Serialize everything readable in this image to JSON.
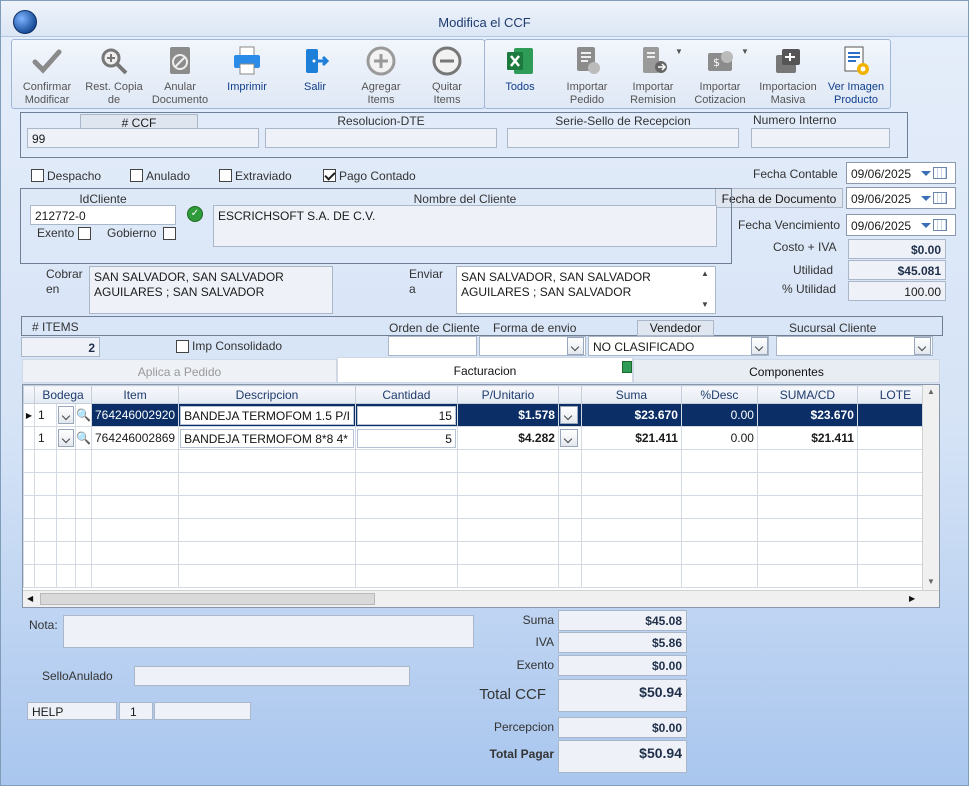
{
  "window": {
    "title": "Modifica el CCF"
  },
  "toolbar": {
    "confirm": [
      "Confirmar",
      "Modificar"
    ],
    "restore": [
      "Rest. Copia",
      "de"
    ],
    "cancel_doc": [
      "Anular",
      "Documento"
    ],
    "print": "Imprimir",
    "exit": "Salir",
    "add_items": [
      "Agregar",
      "Items"
    ],
    "remove_items": [
      "Quitar",
      "Items"
    ],
    "all": "Todos",
    "import_order": [
      "Importar",
      "Pedido"
    ],
    "import_remission": [
      "Importar",
      "Remision"
    ],
    "import_quote": [
      "Importar",
      "Cotizacion"
    ],
    "mass_import": [
      "Importacion",
      "Masiva"
    ],
    "view_image": [
      "Ver Imagen",
      "Producto"
    ]
  },
  "header": {
    "ccf_label": "# CCF",
    "ccf_value": "99",
    "resolution_label": "Resolucion-DTE",
    "resolution_value": "",
    "seal_label": "Serie-Sello de Recepcion",
    "seal_value": "",
    "internal_label": "Numero Interno",
    "internal_value": ""
  },
  "flags": {
    "despacho": {
      "label": "Despacho",
      "checked": false
    },
    "anulado": {
      "label": "Anulado",
      "checked": false
    },
    "extraviado": {
      "label": "Extraviado",
      "checked": false
    },
    "pago_contado": {
      "label": "Pago Contado",
      "checked": true
    }
  },
  "dates": {
    "contable_label": "Fecha Contable",
    "contable": "09/06/2025",
    "documento_label": "Fecha de  Documento",
    "documento": "09/06/2025",
    "vencimiento_label": "Fecha Vencimiento",
    "vencimiento": "09/06/2025"
  },
  "client": {
    "id_label": "IdCliente",
    "id": "212772-0",
    "name_label": "Nombre del Cliente",
    "name": "ESCRICHSOFT S.A. DE C.V.",
    "exento_label": "Exento",
    "gobierno_label": "Gobierno"
  },
  "addresses": {
    "cobrar_label": [
      "Cobrar",
      "en"
    ],
    "cobrar": [
      "SAN SALVADOR, SAN SALVADOR",
      "AGUILARES ; SAN SALVADOR"
    ],
    "enviar_label": [
      "Enviar",
      "a"
    ],
    "enviar": [
      "SAN SALVADOR, SAN SALVADOR",
      "AGUILARES ; SAN SALVADOR"
    ]
  },
  "profit": {
    "costo_label": "Costo + IVA",
    "costo": "$0.00",
    "utilidad_label": "Utilidad",
    "utilidad": "$45.081",
    "pct_label": "% Utilidad",
    "pct": "100.00"
  },
  "order": {
    "items_label": "# ITEMS",
    "items": "2",
    "consolidated_label": "Imp Consolidado",
    "orden_label": "Orden de Cliente",
    "orden": "",
    "forma_label": "Forma de envio",
    "forma": "",
    "vendedor_label": "Vendedor",
    "vendedor": "NO CLASIFICADO",
    "sucursal_label": "Sucursal Cliente",
    "sucursal": ""
  },
  "tabs": [
    "Aplica a Pedido",
    "Facturacion",
    "Componentes"
  ],
  "grid": {
    "columns": [
      "Bodega",
      "Item",
      "Descripcion",
      "Cantidad",
      "P/Unitario",
      "Suma",
      "%Desc",
      "SUMA/CD",
      "LOTE"
    ],
    "rows": [
      {
        "bodega": "1",
        "item": "764246002920",
        "desc": "BANDEJA TERMOFOM 1.5 P/I",
        "cantidad": "15",
        "punit": "$1.578",
        "suma": "$23.670",
        "desc_pct": "0.00",
        "sumacd": "$23.670",
        "lote": ""
      },
      {
        "bodega": "1",
        "item": "764246002869",
        "desc": "BANDEJA TERMOFOM 8*8 4*",
        "cantidad": "5",
        "punit": "$4.282",
        "suma": "$21.411",
        "desc_pct": "0.00",
        "sumacd": "$21.411",
        "lote": ""
      }
    ]
  },
  "footer": {
    "nota_label": "Nota:",
    "nota": "",
    "sello_label": "SelloAnulado",
    "sello": "",
    "help": "HELP",
    "help_num": "1",
    "help_extra": ""
  },
  "totals": {
    "suma_label": "Suma",
    "suma": "$45.08",
    "iva_label": "IVA",
    "iva": "$5.86",
    "exento_label": "Exento",
    "exento": "$0.00",
    "total_label": "Total CCF",
    "total": "$50.94",
    "percepcion_label": "Percepcion",
    "percepcion": "$0.00",
    "pagar_label": "Total Pagar",
    "pagar": "$50.94"
  },
  "colors": {
    "selected_row": "#0b2e66",
    "accent": "#1f3c6e",
    "excel_green": "#1d7a3e"
  }
}
